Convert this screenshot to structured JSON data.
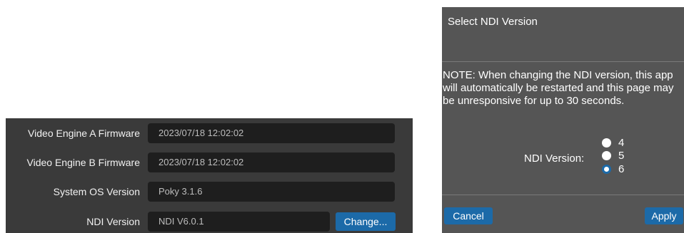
{
  "settings": {
    "rows": [
      {
        "label": "Video Engine A Firmware",
        "value": "2023/07/18 12:02:02"
      },
      {
        "label": "Video Engine B Firmware",
        "value": "2023/07/18 12:02:02"
      },
      {
        "label": "System OS Version",
        "value": "Poky 3.1.6"
      },
      {
        "label": "NDI Version",
        "value": "NDI V6.0.1"
      }
    ],
    "change_label": "Change..."
  },
  "dialog": {
    "title": "Select NDI Version",
    "note": "NOTE: When changing the NDI version, this app will automatically be restarted and this page may be unresponsive for up to 30 seconds.",
    "ndi_label": "NDI Version:",
    "options": [
      {
        "value": "4",
        "selected": false
      },
      {
        "value": "5",
        "selected": false
      },
      {
        "value": "6",
        "selected": true
      }
    ],
    "cancel_label": "Cancel",
    "apply_label": "Apply"
  },
  "colors": {
    "accent": "#1c6aa8",
    "panel_bg": "#3a3a3a",
    "dialog_bg": "#555555",
    "field_bg": "#1e1e1e"
  }
}
